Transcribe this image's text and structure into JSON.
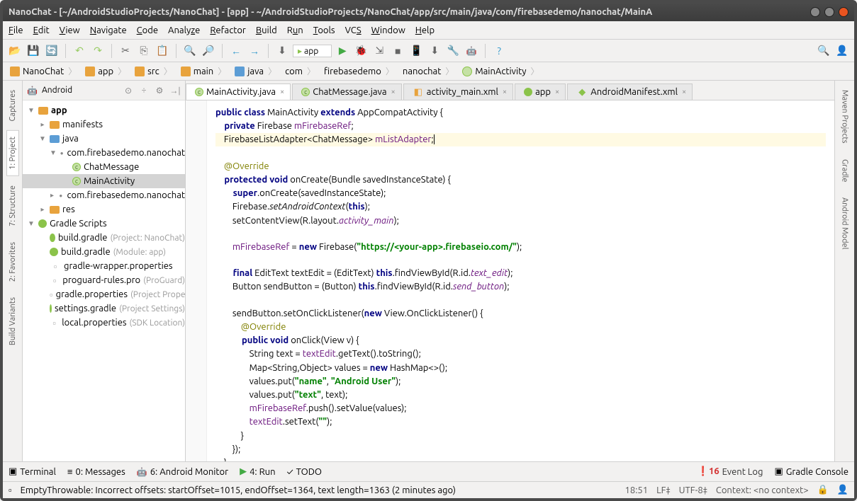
{
  "window": {
    "title": "NanoChat - [~/AndroidStudioProjects/NanoChat] - [app] - ~/AndroidStudioProjects/NanoChat/app/src/main/java/com/firebasedemo/nanochat/MainA"
  },
  "menu": [
    "File",
    "Edit",
    "View",
    "Navigate",
    "Code",
    "Analyze",
    "Refactor",
    "Build",
    "Run",
    "Tools",
    "VCS",
    "Window",
    "Help"
  ],
  "runconfig": "app",
  "breadcrumb": [
    "NanoChat",
    "app",
    "src",
    "main",
    "java",
    "com",
    "firebasedemo",
    "nanochat",
    "MainActivity"
  ],
  "sidebar": {
    "mode": "Android",
    "tree": {
      "app": "app",
      "manifests": "manifests",
      "java": "java",
      "pkg1": "com.firebasedemo.nanochat",
      "chatmessage": "ChatMessage",
      "mainactivity": "MainActivity",
      "pkg2": "com.firebasedemo.nanochat",
      "res": "res",
      "gradle_scripts": "Gradle Scripts",
      "build_gradle_project": "build.gradle",
      "build_gradle_project_hint": "(Project: NanoChat)",
      "build_gradle_module": "build.gradle",
      "build_gradle_module_hint": "(Module: app)",
      "gradle_wrapper": "gradle-wrapper.properties",
      "proguard": "proguard-rules.pro",
      "proguard_hint": "(ProGuard)",
      "gradle_props": "gradle.properties",
      "gradle_props_hint": "(Project Properties)",
      "settings_gradle": "settings.gradle",
      "settings_gradle_hint": "(Project Settings)",
      "local_props": "local.properties",
      "local_props_hint": "(SDK Location)"
    }
  },
  "tabs": [
    {
      "label": "MainActivity.java",
      "type": "class",
      "active": true
    },
    {
      "label": "ChatMessage.java",
      "type": "class"
    },
    {
      "label": "activity_main.xml",
      "type": "xml"
    },
    {
      "label": "app",
      "type": "gradle"
    },
    {
      "label": "AndroidManifest.xml",
      "type": "xml"
    }
  ],
  "left_tabs": [
    "Captures",
    "1: Project",
    "7: Structure",
    "2: Favorites",
    "Build Variants"
  ],
  "right_tabs": [
    "Maven Projects",
    "Gradle",
    "Android Model"
  ],
  "bottom_tabs": {
    "terminal": "Terminal",
    "messages": "0: Messages",
    "monitor": "6: Android Monitor",
    "run": "4: Run",
    "todo": "TODO",
    "eventlog": "Event Log",
    "eventlog_count": "16",
    "gradle_console": "Gradle Console"
  },
  "status": {
    "msg": "EmptyThrowable: Incorrect offsets: startOffset=1015, endOffset=1364, text length=1363 (2 minutes ago)",
    "time": "18:51",
    "lf": "LF",
    "enc": "UTF-8",
    "context": "Context: <no context>"
  },
  "code": {
    "l1a": "public class",
    "l1b": " MainActivity ",
    "l1c": "extends",
    "l1d": " AppCompatActivity {",
    "l2a": "    private",
    "l2b": " Firebase ",
    "l2c": "mFirebaseRef",
    "l2d": ";",
    "l3a": "    FirebaseListAdapter<ChatMessage> ",
    "l3b": "mListAdapter",
    "l3c": ";",
    "l5": "    @Override",
    "l6a": "    protected void",
    "l6b": " onCreate(Bundle savedInstanceState) {",
    "l7a": "        super",
    "l7b": ".onCreate(savedInstanceState);",
    "l8a": "        Firebase.",
    "l8b": "setAndroidContext",
    "l8c": "(",
    "l8d": "this",
    "l8e": ");",
    "l9a": "        setContentView(R.layout.",
    "l9b": "activity_main",
    "l9c": ");",
    "l11a": "        mFirebaseRef",
    "l11b": " = ",
    "l11c": "new",
    "l11d": " Firebase(",
    "l11e": "\"https://<your-app>.firebaseio.com/\"",
    "l11f": ");",
    "l13a": "        final",
    "l13b": " EditText textEdit = (EditText) ",
    "l13c": "this",
    "l13d": ".findViewById(R.id.",
    "l13e": "text_edit",
    "l13f": ");",
    "l14a": "        Button sendButton = (Button) ",
    "l14b": "this",
    "l14c": ".findViewById(R.id.",
    "l14d": "send_button",
    "l14e": ");",
    "l16a": "        sendButton.setOnClickListener(",
    "l16b": "new",
    "l16c": " View.OnClickListener() {",
    "l17": "            @Override",
    "l18a": "            public void",
    "l18b": " onClick(View v) {",
    "l19a": "                String text = ",
    "l19b": "textEdit",
    "l19c": ".getText().toString();",
    "l20a": "                Map<String,Object> values = ",
    "l20b": "new",
    "l20c": " HashMap<>();",
    "l21a": "                values.put(",
    "l21b": "\"name\"",
    "l21c": ", ",
    "l21d": "\"Android User\"",
    "l21e": ");",
    "l22a": "                values.put(",
    "l22b": "\"text\"",
    "l22c": ", text);",
    "l23a": "                mFirebaseRef",
    "l23b": ".push().setValue(values);",
    "l24a": "                textEdit",
    "l24b": ".setText(",
    "l24c": "\"\"",
    "l24d": ");",
    "l25": "            }",
    "l26": "        });",
    "l27": "    }",
    "l28": "}"
  }
}
